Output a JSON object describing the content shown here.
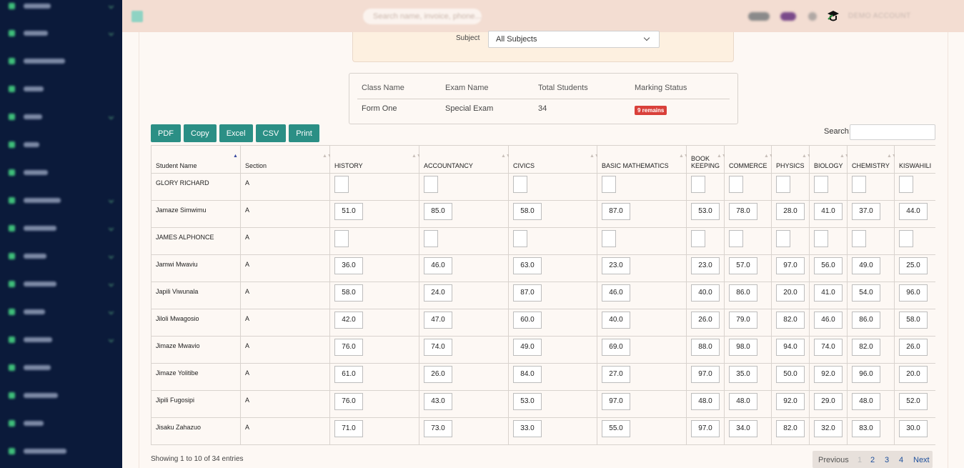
{
  "topbar": {
    "search_placeholder": "Search name, invoice, phone...",
    "account_label": "DEMO ACCOUNT"
  },
  "filter": {
    "subject_label": "Subject",
    "subject_value": "All Subjects"
  },
  "summary": {
    "headers": [
      "Class Name",
      "Exam Name",
      "Total Students",
      "Marking Status"
    ],
    "class_name": "Form One",
    "exam_name": "Special Exam",
    "total_students": "34",
    "marking_status": "9 remains"
  },
  "export_buttons": [
    "PDF",
    "Copy",
    "Excel",
    "CSV",
    "Print"
  ],
  "search_label": "Search:",
  "table": {
    "columns": [
      "Student Name",
      "Section",
      "HISTORY",
      "ACCOUNTANCY",
      "CIVICS",
      "BASIC MATHEMATICS",
      "BOOK KEEPING",
      "COMMERCE",
      "PHYSICS",
      "BIOLOGY",
      "CHEMISTRY",
      "KISWAHILI"
    ],
    "rows": [
      {
        "name": "GLORY RICHARD",
        "section": "A",
        "scores": [
          "",
          "",
          "",
          "",
          "",
          "",
          "",
          "",
          "",
          ""
        ]
      },
      {
        "name": "Jamaze Simwimu",
        "section": "A",
        "scores": [
          "51.0",
          "85.0",
          "58.0",
          "87.0",
          "53.0",
          "78.0",
          "28.0",
          "41.0",
          "37.0",
          "44.0"
        ]
      },
      {
        "name": "JAMES ALPHONCE",
        "section": "A",
        "scores": [
          "",
          "",
          "",
          "",
          "",
          "",
          "",
          "",
          "",
          ""
        ]
      },
      {
        "name": "Jamwi Mwaviu",
        "section": "A",
        "scores": [
          "36.0",
          "46.0",
          "63.0",
          "23.0",
          "23.0",
          "57.0",
          "97.0",
          "56.0",
          "49.0",
          "25.0"
        ]
      },
      {
        "name": "Japili Viwunala",
        "section": "A",
        "scores": [
          "58.0",
          "24.0",
          "87.0",
          "46.0",
          "40.0",
          "86.0",
          "20.0",
          "41.0",
          "54.0",
          "96.0"
        ]
      },
      {
        "name": "Jiloli Mwagosio",
        "section": "A",
        "scores": [
          "42.0",
          "47.0",
          "60.0",
          "40.0",
          "26.0",
          "79.0",
          "82.0",
          "46.0",
          "86.0",
          "58.0"
        ]
      },
      {
        "name": "Jimaze Mwavio",
        "section": "A",
        "scores": [
          "76.0",
          "74.0",
          "49.0",
          "69.0",
          "88.0",
          "98.0",
          "94.0",
          "74.0",
          "82.0",
          "26.0"
        ]
      },
      {
        "name": "Jimaze Yolitibe",
        "section": "A",
        "scores": [
          "61.0",
          "26.0",
          "84.0",
          "27.0",
          "97.0",
          "35.0",
          "50.0",
          "92.0",
          "96.0",
          "20.0"
        ]
      },
      {
        "name": "Jipili Fugosipi",
        "section": "A",
        "scores": [
          "76.0",
          "43.0",
          "53.0",
          "97.0",
          "48.0",
          "48.0",
          "92.0",
          "29.0",
          "48.0",
          "52.0"
        ]
      },
      {
        "name": "Jisaku Zahazuo",
        "section": "A",
        "scores": [
          "71.0",
          "73.0",
          "33.0",
          "55.0",
          "97.0",
          "34.0",
          "82.0",
          "32.0",
          "83.0",
          "30.0"
        ]
      }
    ]
  },
  "footer": {
    "showing": "Showing 1 to 10 of 34 entries",
    "pager": {
      "previous": "Previous",
      "pages": [
        "1",
        "2",
        "3",
        "4"
      ],
      "next": "Next"
    }
  }
}
